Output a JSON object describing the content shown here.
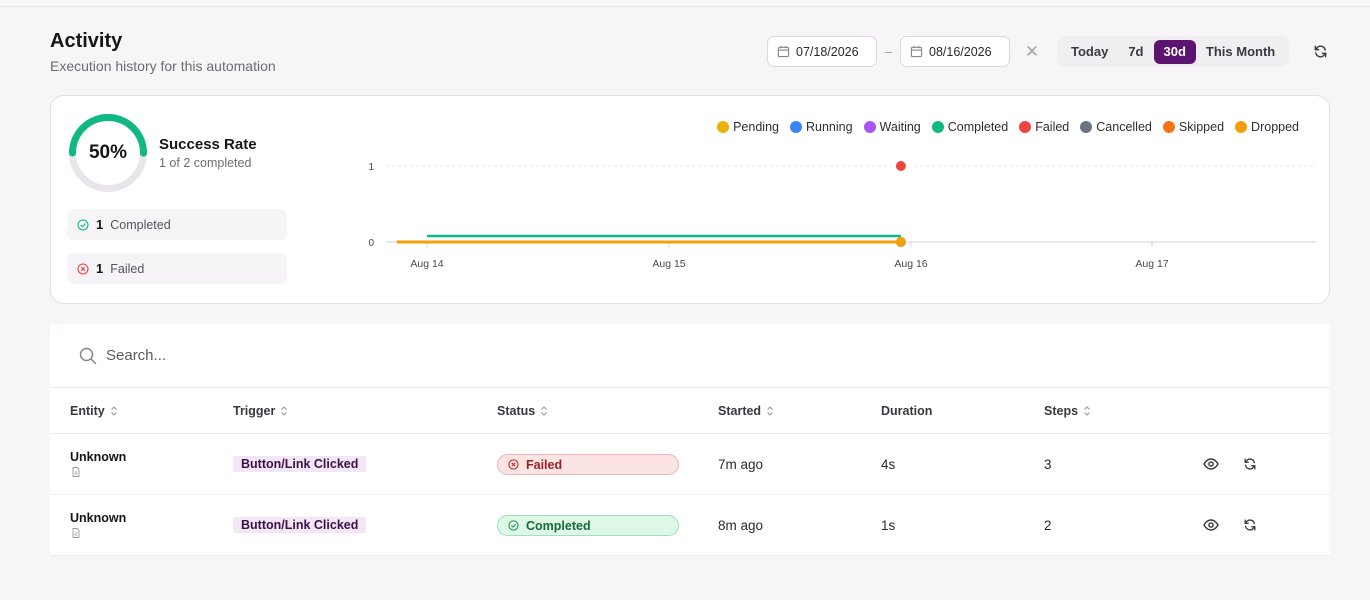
{
  "header": {
    "title": "Activity",
    "subtitle": "Execution history for this automation"
  },
  "toolbar": {
    "start_date": "07/18/2026",
    "end_date": "08/16/2026",
    "separator": "–",
    "clear_symbol": "✕",
    "ranges": [
      "Today",
      "7d",
      "30d",
      "This Month"
    ],
    "active_range": "30d",
    "accent_color": "#5b1470"
  },
  "summary": {
    "percent_label": "50%",
    "success_fraction": 0.5,
    "title": "Success Rate",
    "subtitle": "1 of 2 completed",
    "completed_count": "1",
    "completed_label": "Completed",
    "failed_count": "1",
    "failed_label": "Failed"
  },
  "legend": [
    {
      "label": "Pending",
      "color": "#eab308"
    },
    {
      "label": "Running",
      "color": "#3b82f6"
    },
    {
      "label": "Waiting",
      "color": "#a855f7"
    },
    {
      "label": "Completed",
      "color": "#10b981"
    },
    {
      "label": "Failed",
      "color": "#ef4444"
    },
    {
      "label": "Cancelled",
      "color": "#6b7280"
    },
    {
      "label": "Skipped",
      "color": "#f97316"
    },
    {
      "label": "Dropped",
      "color": "#f59e0b"
    }
  ],
  "chart_data": {
    "type": "line",
    "x_tick_labels": [
      "Aug 14",
      "Aug 15",
      "Aug 16",
      "Aug 17"
    ],
    "y_tick_labels": [
      "0",
      "1"
    ],
    "ylim": [
      0,
      1
    ],
    "grid": true,
    "legend_position": "top-right",
    "series": [
      {
        "name": "Completed",
        "color": "#10b981",
        "points": [
          [
            "Aug 14",
            0
          ],
          [
            "Aug 15 23:00",
            0
          ]
        ]
      },
      {
        "name": "Failed",
        "color": "#ef4444",
        "points": [
          [
            "Aug 15 23:00",
            1
          ]
        ]
      },
      {
        "name": "Dropped",
        "color": "#f59e0b",
        "points": [
          [
            "Aug 13 21:00",
            0
          ],
          [
            "Aug 15 23:00",
            0
          ]
        ]
      }
    ]
  },
  "search": {
    "placeholder": "Search..."
  },
  "table": {
    "columns": [
      "Entity",
      "Trigger",
      "Status",
      "Started",
      "Duration",
      "Steps"
    ],
    "rows": [
      {
        "entity": "Unknown",
        "trigger": "Button/Link Clicked",
        "status": "Failed",
        "started": "7m ago",
        "duration": "4s",
        "steps": "3"
      },
      {
        "entity": "Unknown",
        "trigger": "Button/Link Clicked",
        "status": "Completed",
        "started": "8m ago",
        "duration": "1s",
        "steps": "2"
      }
    ]
  }
}
